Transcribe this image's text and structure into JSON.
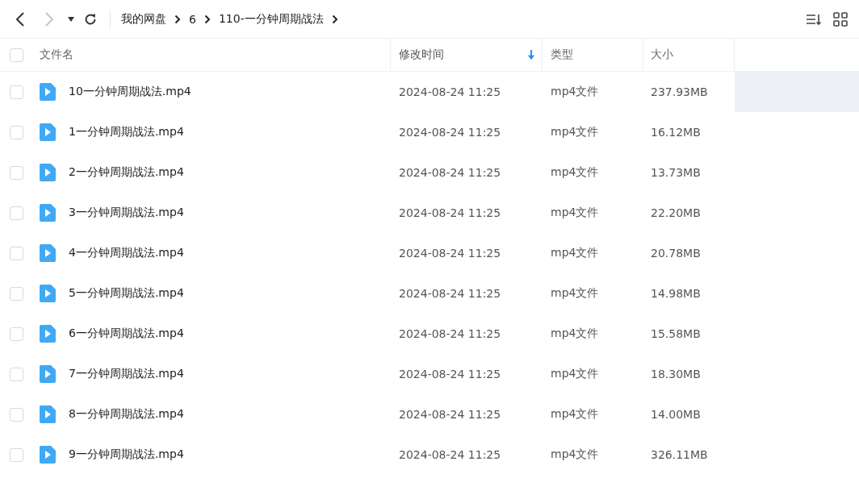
{
  "toolbar": {
    "back_disabled": false,
    "forward_disabled": true
  },
  "breadcrumbs": [
    {
      "label": "我的网盘"
    },
    {
      "label": "6"
    },
    {
      "label": "110-一分钟周期战法"
    }
  ],
  "table": {
    "all_checked": false,
    "columns": [
      {
        "label": "文件名",
        "sorted": false
      },
      {
        "label": "修改时间",
        "sorted": true
      },
      {
        "label": "类型",
        "sorted": false
      },
      {
        "label": "大小",
        "sorted": false
      }
    ],
    "rows": [
      {
        "name": "10一分钟周期战法.mp4",
        "modified": "2024-08-24 11:25",
        "type": "mp4文件",
        "size": "237.93MB",
        "checked": false,
        "hovered": true
      },
      {
        "name": "1一分钟周期战法.mp4",
        "modified": "2024-08-24 11:25",
        "type": "mp4文件",
        "size": "16.12MB",
        "checked": false,
        "hovered": false
      },
      {
        "name": "2一分钟周期战法.mp4",
        "modified": "2024-08-24 11:25",
        "type": "mp4文件",
        "size": "13.73MB",
        "checked": false,
        "hovered": false
      },
      {
        "name": "3一分钟周期战法.mp4",
        "modified": "2024-08-24 11:25",
        "type": "mp4文件",
        "size": "22.20MB",
        "checked": false,
        "hovered": false
      },
      {
        "name": "4一分钟周期战法.mp4",
        "modified": "2024-08-24 11:25",
        "type": "mp4文件",
        "size": "20.78MB",
        "checked": false,
        "hovered": false
      },
      {
        "name": "5一分钟周期战法.mp4",
        "modified": "2024-08-24 11:25",
        "type": "mp4文件",
        "size": "14.98MB",
        "checked": false,
        "hovered": false
      },
      {
        "name": "6一分钟周期战法.mp4",
        "modified": "2024-08-24 11:25",
        "type": "mp4文件",
        "size": "15.58MB",
        "checked": false,
        "hovered": false
      },
      {
        "name": "7一分钟周期战法.mp4",
        "modified": "2024-08-24 11:25",
        "type": "mp4文件",
        "size": "18.30MB",
        "checked": false,
        "hovered": false
      },
      {
        "name": "8一分钟周期战法.mp4",
        "modified": "2024-08-24 11:25",
        "type": "mp4文件",
        "size": "14.00MB",
        "checked": false,
        "hovered": false
      },
      {
        "name": "9一分钟周期战法.mp4",
        "modified": "2024-08-24 11:25",
        "type": "mp4文件",
        "size": "326.11MB",
        "checked": false,
        "hovered": false
      }
    ]
  }
}
